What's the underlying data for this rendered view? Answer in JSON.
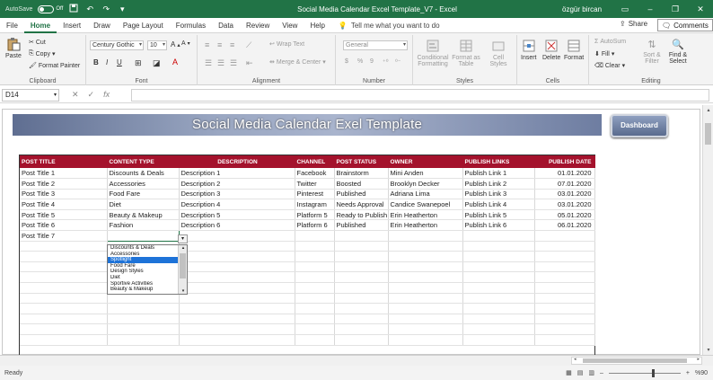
{
  "window": {
    "autosave_label": "AutoSave",
    "autosave_state": "Off",
    "title": "Social Media Calendar Excel Template_V7  -  Excel",
    "user": "özgür bircan"
  },
  "tabs": [
    "File",
    "Home",
    "Insert",
    "Draw",
    "Page Layout",
    "Formulas",
    "Data",
    "Review",
    "View",
    "Help"
  ],
  "active_tab": "Home",
  "tell_me": "Tell me what you want to do",
  "share_label": "Share",
  "comments_label": "Comments",
  "ribbon": {
    "clipboard": {
      "label": "Clipboard",
      "paste": "Paste",
      "cut": "Cut",
      "copy": "Copy",
      "format_painter": "Format Painter"
    },
    "font": {
      "label": "Font",
      "font_name": "Century Gothic",
      "font_size": "10",
      "bold": "B",
      "italic": "I",
      "underline": "U"
    },
    "alignment": {
      "label": "Alignment",
      "wrap_text": "Wrap Text",
      "merge_center": "Merge & Center"
    },
    "number": {
      "label": "Number",
      "format": "General",
      "currency": "$",
      "percent": "%",
      "comma": "9"
    },
    "styles": {
      "label": "Styles",
      "conditional": "Conditional Formatting",
      "format_table": "Format as Table",
      "cell_styles": "Cell Styles"
    },
    "cells": {
      "label": "Cells",
      "insert": "Insert",
      "delete": "Delete",
      "format": "Format"
    },
    "editing": {
      "label": "Editing",
      "autosum": "AutoSum",
      "fill": "Fill",
      "clear": "Clear",
      "sort_filter": "Sort & Filter",
      "find_select": "Find & Select"
    }
  },
  "formula_bar": {
    "name_box": "D14",
    "formula": "",
    "fx": "fx"
  },
  "sheet": {
    "banner_title": "Social Media Calendar Exel Template",
    "dashboard_button": "Dashboard",
    "columns": [
      "POST TITLE",
      "CONTENT TYPE",
      "DESCRIPTION",
      "CHANNEL",
      "POST STATUS",
      "OWNER",
      "PUBLISH LINKS",
      "PUBLISH DATE"
    ],
    "rows": [
      [
        "Post Title 1",
        "Discounts & Deals",
        "Description 1",
        "Facebook",
        "Brainstorm",
        "Mini Anden",
        "Publish Link 1",
        "01.01.2020"
      ],
      [
        "Post Title 2",
        "Accessories",
        "Description 2",
        "Twitter",
        "Boosted",
        "Brooklyn Decker",
        "Publish Link 2",
        "07.01.2020"
      ],
      [
        "Post Title 3",
        "Food Fare",
        "Description 3",
        "Pinterest",
        "Published",
        "Adriana Lima",
        "Publish Link 3",
        "03.01.2020"
      ],
      [
        "Post Title 4",
        "Diet",
        "Description 4",
        "Instagram",
        "Needs Approval",
        "Candice Swanepoel",
        "Publish Link 4",
        "03.01.2020"
      ],
      [
        "Post Title 5",
        "Beauty & Makeup",
        "Description 5",
        "Platform 5",
        "Ready to Publish",
        "Erin Heatherton",
        "Publish Link 5",
        "05.01.2020"
      ],
      [
        "Post Title 6",
        "Fashion",
        "Description 6",
        "Platform 6",
        "Published",
        "Erin Heatherton",
        "Publish Link 6",
        "06.01.2020"
      ],
      [
        "Post Title 7",
        "",
        "",
        "",
        "",
        "",
        "",
        ""
      ]
    ],
    "empty_rows": 10,
    "dropdown_options": [
      "Discounts & Deals",
      "Accessories",
      "Spotlight",
      "Food Fare",
      "Design Styles",
      "Diet",
      "Sportive Activities",
      "Beauty & Makeup"
    ],
    "dropdown_selected": "Spotlight"
  },
  "status": {
    "ready": "Ready",
    "zoom": "%90"
  },
  "colors": {
    "excel_green": "#217346",
    "header_red": "#a4122c",
    "selection_blue": "#1e73d8"
  }
}
